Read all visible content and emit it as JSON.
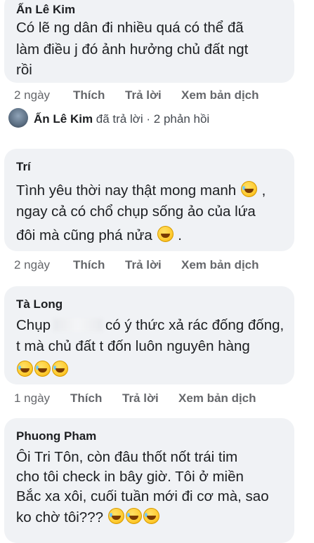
{
  "comments": [
    {
      "author": "Ấn Lê Kim",
      "lines": [
        "Có lẽ ng dân đi nhiều quá có thể đã",
        "làm điều j đó ảnh hưởng chủ đất ngt",
        "rồi"
      ],
      "time": "2 ngày",
      "like": "Thích",
      "reply": "Trả lời",
      "translate": "Xem bản dịch"
    },
    {
      "author": "Trí",
      "lines": [
        "Tình yêu thời nay thật mong manh",
        ", ",
        "ngay cả có chổ chụp sống ảo của lứa",
        "đôi mà cũng phá nửa",
        "."
      ],
      "emoji": [
        "crying-laughing-emoji",
        "grinning-sweat-emoji"
      ],
      "time": "2 ngày",
      "like": "Thích",
      "reply": "Trả lời",
      "translate": "Xem bản dịch"
    },
    {
      "author": "Tà Long",
      "lines": [
        "Chụp",
        "có ý thức xả rác đống đống,",
        "t mà chủ đất t đốn luôn nguyên hàng"
      ],
      "emoji": [
        "rolling-laughing-emoji",
        "rolling-laughing-emoji",
        "rolling-laughing-emoji"
      ],
      "time": "1 ngày",
      "like": "Thích",
      "reply": "Trả lời",
      "translate": "Xem bản dịch"
    },
    {
      "author": "Phuong Pham",
      "lines": [
        "Ôi Tri Tôn, còn đâu thốt nốt trái tim",
        "cho tôi check in bây giờ. Tôi ở miền",
        "Bắc xa xôi, cuối tuần mới đi cơ mà, sao",
        "ko chờ tôi???"
      ],
      "emoji": [
        "loudly-crying-emoji",
        "loudly-crying-emoji",
        "loudly-crying-emoji"
      ]
    }
  ],
  "reply_summary": {
    "name": "Ấn Lê Kim",
    "text": " đã trả lời · 2 phản hồi"
  }
}
